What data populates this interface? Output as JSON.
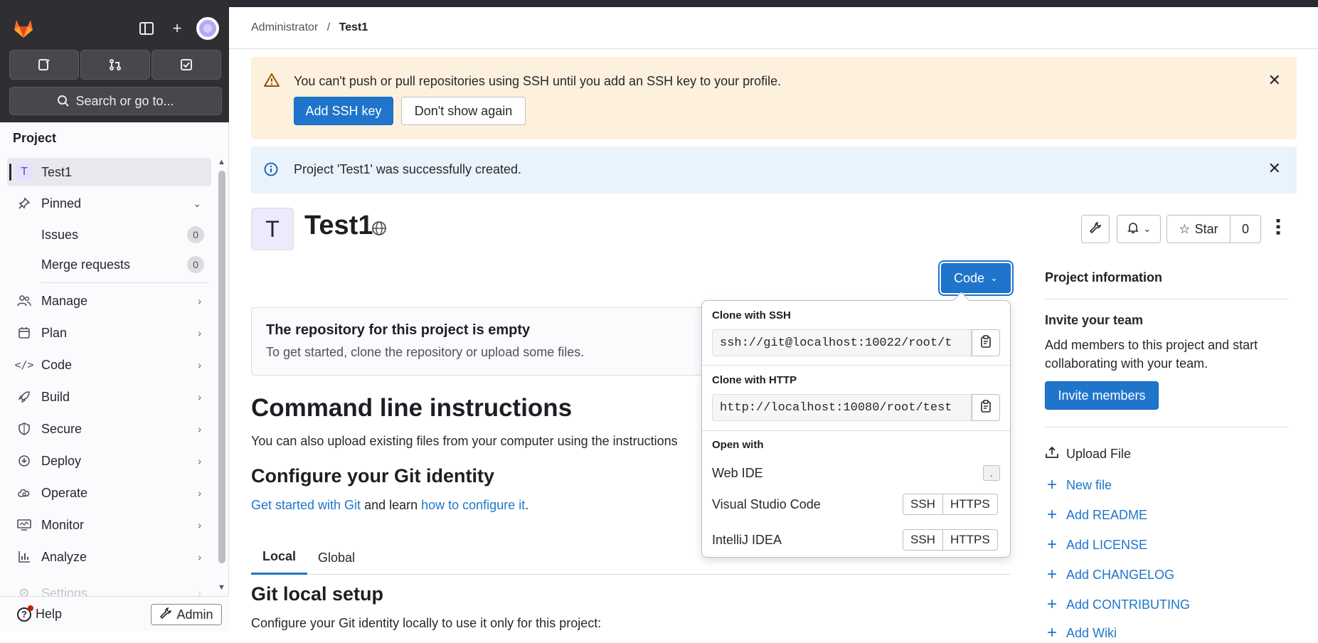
{
  "sidebar": {
    "search_placeholder": "Search or go to...",
    "section_title": "Project",
    "project_item": {
      "initial": "T",
      "label": "Test1"
    },
    "pinned_label": "Pinned",
    "pinned_items": [
      {
        "label": "Issues",
        "count": "0"
      },
      {
        "label": "Merge requests",
        "count": "0"
      }
    ],
    "nav_items": [
      {
        "label": "Manage",
        "icon": "users-icon"
      },
      {
        "label": "Plan",
        "icon": "calendar-icon"
      },
      {
        "label": "Code",
        "icon": "code-icon"
      },
      {
        "label": "Build",
        "icon": "rocket-icon"
      },
      {
        "label": "Secure",
        "icon": "shield-icon"
      },
      {
        "label": "Deploy",
        "icon": "deploy-icon"
      },
      {
        "label": "Operate",
        "icon": "cloud-icon"
      },
      {
        "label": "Monitor",
        "icon": "monitor-icon"
      },
      {
        "label": "Analyze",
        "icon": "chart-icon"
      },
      {
        "label": "Settings",
        "icon": "gear-icon"
      }
    ],
    "help_label": "Help",
    "admin_label": "Admin"
  },
  "breadcrumb": {
    "parent": "Administrator",
    "separator": "/",
    "current": "Test1"
  },
  "alerts": {
    "ssh": {
      "message": "You can't push or pull repositories using SSH until you add an SSH key to your profile.",
      "primary": "Add SSH key",
      "secondary": "Don't show again"
    },
    "created": {
      "message": "Project 'Test1' was successfully created."
    }
  },
  "project": {
    "initial": "T",
    "name": "Test1",
    "star_label": "Star",
    "star_count": "0",
    "code_button": "Code"
  },
  "empty_repo": {
    "title": "The repository for this project is empty",
    "text": "To get started, clone the repository or upload some files."
  },
  "cli": {
    "heading": "Command line instructions",
    "text": "You can also upload existing files from your computer using the instructions",
    "config_heading": "Configure your Git identity",
    "link1": "Get started with Git",
    "mid_text": " and learn ",
    "link2": "how to configure it",
    "end_text": ".",
    "tabs": [
      "Local",
      "Global"
    ],
    "local_heading": "Git local setup",
    "local_text": "Configure your Git identity locally to use it only for this project:"
  },
  "code_dropdown": {
    "ssh_title": "Clone with SSH",
    "ssh_url": "ssh://git@localhost:10022/root/t",
    "http_title": "Clone with HTTP",
    "http_url": "http://localhost:10080/root/test",
    "open_with": "Open with",
    "web_ide": "Web IDE",
    "web_ide_key": ".",
    "vscode": "Visual Studio Code",
    "intellij": "IntelliJ IDEA",
    "ssh": "SSH",
    "https": "HTTPS"
  },
  "project_info": {
    "title": "Project information",
    "invite_title": "Invite your team",
    "invite_text": "Add members to this project and start collaborating with your team.",
    "invite_button": "Invite members",
    "upload": "Upload File",
    "links": [
      "New file",
      "Add README",
      "Add LICENSE",
      "Add CHANGELOG",
      "Add CONTRIBUTING",
      "Add Wiki"
    ]
  },
  "colors": {
    "accent": "#1f75cb",
    "warning_bg": "#fdf1dd",
    "info_bg": "#e9f3fc",
    "sidebar_dark": "#2e2e33"
  }
}
